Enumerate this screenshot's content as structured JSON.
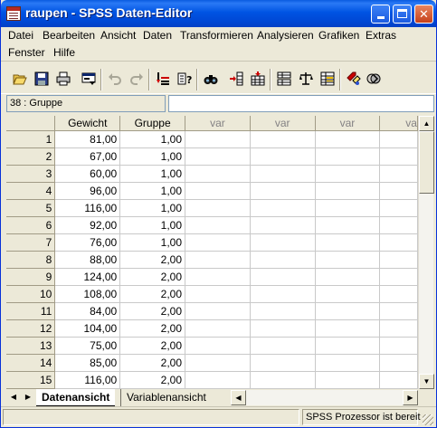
{
  "window": {
    "title": "raupen - SPSS Daten-Editor",
    "icon": "spss-data-editor-icon"
  },
  "menu": {
    "items": [
      "Datei",
      "Bearbeiten",
      "Ansicht",
      "Daten",
      "Transformieren",
      "Analysieren",
      "Grafiken",
      "Extras"
    ],
    "items_row2": [
      "Fenster",
      "Hilfe"
    ]
  },
  "toolbar": {
    "icons": [
      "open-icon",
      "save-icon",
      "print-icon",
      "dialog-recall-icon",
      "undo-icon",
      "redo-icon",
      "goto-case-icon",
      "variables-icon",
      "find-icon",
      "insert-case-icon",
      "insert-variable-icon",
      "split-file-icon",
      "weight-cases-icon",
      "select-cases-icon",
      "value-labels-icon",
      "use-sets-icon"
    ]
  },
  "cellbar": {
    "reference": "38 : Gruppe",
    "value": ""
  },
  "grid": {
    "columns": [
      "Gewicht",
      "Gruppe",
      "var",
      "var",
      "var",
      "va"
    ],
    "rows": [
      {
        "n": "1",
        "gewicht": "81,00",
        "gruppe": "1,00"
      },
      {
        "n": "2",
        "gewicht": "67,00",
        "gruppe": "1,00"
      },
      {
        "n": "3",
        "gewicht": "60,00",
        "gruppe": "1,00"
      },
      {
        "n": "4",
        "gewicht": "96,00",
        "gruppe": "1,00"
      },
      {
        "n": "5",
        "gewicht": "116,00",
        "gruppe": "1,00"
      },
      {
        "n": "6",
        "gewicht": "92,00",
        "gruppe": "1,00"
      },
      {
        "n": "7",
        "gewicht": "76,00",
        "gruppe": "1,00"
      },
      {
        "n": "8",
        "gewicht": "88,00",
        "gruppe": "2,00"
      },
      {
        "n": "9",
        "gewicht": "124,00",
        "gruppe": "2,00"
      },
      {
        "n": "10",
        "gewicht": "108,00",
        "gruppe": "2,00"
      },
      {
        "n": "11",
        "gewicht": "84,00",
        "gruppe": "2,00"
      },
      {
        "n": "12",
        "gewicht": "104,00",
        "gruppe": "2,00"
      },
      {
        "n": "13",
        "gewicht": "75,00",
        "gruppe": "2,00"
      },
      {
        "n": "14",
        "gewicht": "85,00",
        "gruppe": "2,00"
      },
      {
        "n": "15",
        "gewicht": "116,00",
        "gruppe": "2,00"
      }
    ]
  },
  "tabs": {
    "data_view": "Datenansicht",
    "variable_view": "Variablenansicht"
  },
  "status": {
    "text": "SPSS Prozessor  ist bereit"
  }
}
